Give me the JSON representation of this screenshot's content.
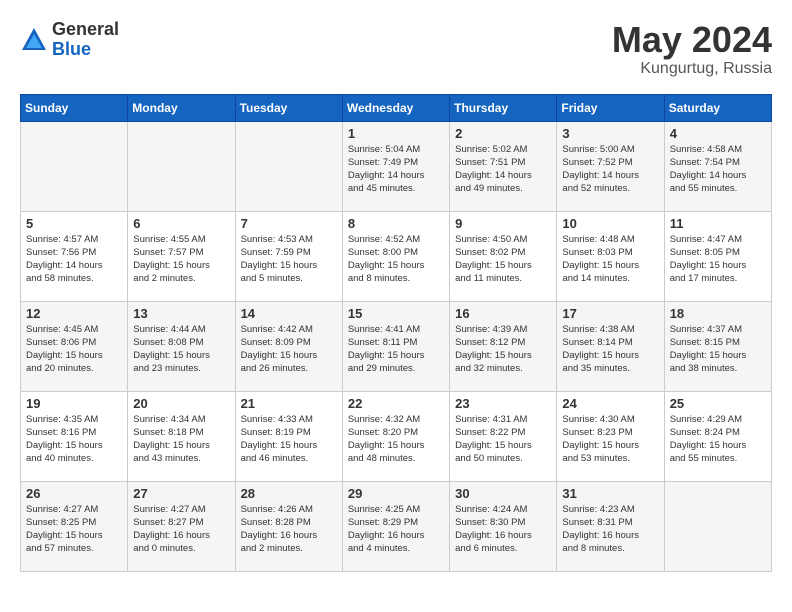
{
  "logo": {
    "general": "General",
    "blue": "Blue"
  },
  "title": "May 2024",
  "location": "Kungurtug, Russia",
  "weekdays": [
    "Sunday",
    "Monday",
    "Tuesday",
    "Wednesday",
    "Thursday",
    "Friday",
    "Saturday"
  ],
  "weeks": [
    [
      {
        "day": "",
        "info": ""
      },
      {
        "day": "",
        "info": ""
      },
      {
        "day": "",
        "info": ""
      },
      {
        "day": "1",
        "info": "Sunrise: 5:04 AM\nSunset: 7:49 PM\nDaylight: 14 hours\nand 45 minutes."
      },
      {
        "day": "2",
        "info": "Sunrise: 5:02 AM\nSunset: 7:51 PM\nDaylight: 14 hours\nand 49 minutes."
      },
      {
        "day": "3",
        "info": "Sunrise: 5:00 AM\nSunset: 7:52 PM\nDaylight: 14 hours\nand 52 minutes."
      },
      {
        "day": "4",
        "info": "Sunrise: 4:58 AM\nSunset: 7:54 PM\nDaylight: 14 hours\nand 55 minutes."
      }
    ],
    [
      {
        "day": "5",
        "info": "Sunrise: 4:57 AM\nSunset: 7:56 PM\nDaylight: 14 hours\nand 58 minutes."
      },
      {
        "day": "6",
        "info": "Sunrise: 4:55 AM\nSunset: 7:57 PM\nDaylight: 15 hours\nand 2 minutes."
      },
      {
        "day": "7",
        "info": "Sunrise: 4:53 AM\nSunset: 7:59 PM\nDaylight: 15 hours\nand 5 minutes."
      },
      {
        "day": "8",
        "info": "Sunrise: 4:52 AM\nSunset: 8:00 PM\nDaylight: 15 hours\nand 8 minutes."
      },
      {
        "day": "9",
        "info": "Sunrise: 4:50 AM\nSunset: 8:02 PM\nDaylight: 15 hours\nand 11 minutes."
      },
      {
        "day": "10",
        "info": "Sunrise: 4:48 AM\nSunset: 8:03 PM\nDaylight: 15 hours\nand 14 minutes."
      },
      {
        "day": "11",
        "info": "Sunrise: 4:47 AM\nSunset: 8:05 PM\nDaylight: 15 hours\nand 17 minutes."
      }
    ],
    [
      {
        "day": "12",
        "info": "Sunrise: 4:45 AM\nSunset: 8:06 PM\nDaylight: 15 hours\nand 20 minutes."
      },
      {
        "day": "13",
        "info": "Sunrise: 4:44 AM\nSunset: 8:08 PM\nDaylight: 15 hours\nand 23 minutes."
      },
      {
        "day": "14",
        "info": "Sunrise: 4:42 AM\nSunset: 8:09 PM\nDaylight: 15 hours\nand 26 minutes."
      },
      {
        "day": "15",
        "info": "Sunrise: 4:41 AM\nSunset: 8:11 PM\nDaylight: 15 hours\nand 29 minutes."
      },
      {
        "day": "16",
        "info": "Sunrise: 4:39 AM\nSunset: 8:12 PM\nDaylight: 15 hours\nand 32 minutes."
      },
      {
        "day": "17",
        "info": "Sunrise: 4:38 AM\nSunset: 8:14 PM\nDaylight: 15 hours\nand 35 minutes."
      },
      {
        "day": "18",
        "info": "Sunrise: 4:37 AM\nSunset: 8:15 PM\nDaylight: 15 hours\nand 38 minutes."
      }
    ],
    [
      {
        "day": "19",
        "info": "Sunrise: 4:35 AM\nSunset: 8:16 PM\nDaylight: 15 hours\nand 40 minutes."
      },
      {
        "day": "20",
        "info": "Sunrise: 4:34 AM\nSunset: 8:18 PM\nDaylight: 15 hours\nand 43 minutes."
      },
      {
        "day": "21",
        "info": "Sunrise: 4:33 AM\nSunset: 8:19 PM\nDaylight: 15 hours\nand 46 minutes."
      },
      {
        "day": "22",
        "info": "Sunrise: 4:32 AM\nSunset: 8:20 PM\nDaylight: 15 hours\nand 48 minutes."
      },
      {
        "day": "23",
        "info": "Sunrise: 4:31 AM\nSunset: 8:22 PM\nDaylight: 15 hours\nand 50 minutes."
      },
      {
        "day": "24",
        "info": "Sunrise: 4:30 AM\nSunset: 8:23 PM\nDaylight: 15 hours\nand 53 minutes."
      },
      {
        "day": "25",
        "info": "Sunrise: 4:29 AM\nSunset: 8:24 PM\nDaylight: 15 hours\nand 55 minutes."
      }
    ],
    [
      {
        "day": "26",
        "info": "Sunrise: 4:27 AM\nSunset: 8:25 PM\nDaylight: 15 hours\nand 57 minutes."
      },
      {
        "day": "27",
        "info": "Sunrise: 4:27 AM\nSunset: 8:27 PM\nDaylight: 16 hours\nand 0 minutes."
      },
      {
        "day": "28",
        "info": "Sunrise: 4:26 AM\nSunset: 8:28 PM\nDaylight: 16 hours\nand 2 minutes."
      },
      {
        "day": "29",
        "info": "Sunrise: 4:25 AM\nSunset: 8:29 PM\nDaylight: 16 hours\nand 4 minutes."
      },
      {
        "day": "30",
        "info": "Sunrise: 4:24 AM\nSunset: 8:30 PM\nDaylight: 16 hours\nand 6 minutes."
      },
      {
        "day": "31",
        "info": "Sunrise: 4:23 AM\nSunset: 8:31 PM\nDaylight: 16 hours\nand 8 minutes."
      },
      {
        "day": "",
        "info": ""
      }
    ]
  ]
}
